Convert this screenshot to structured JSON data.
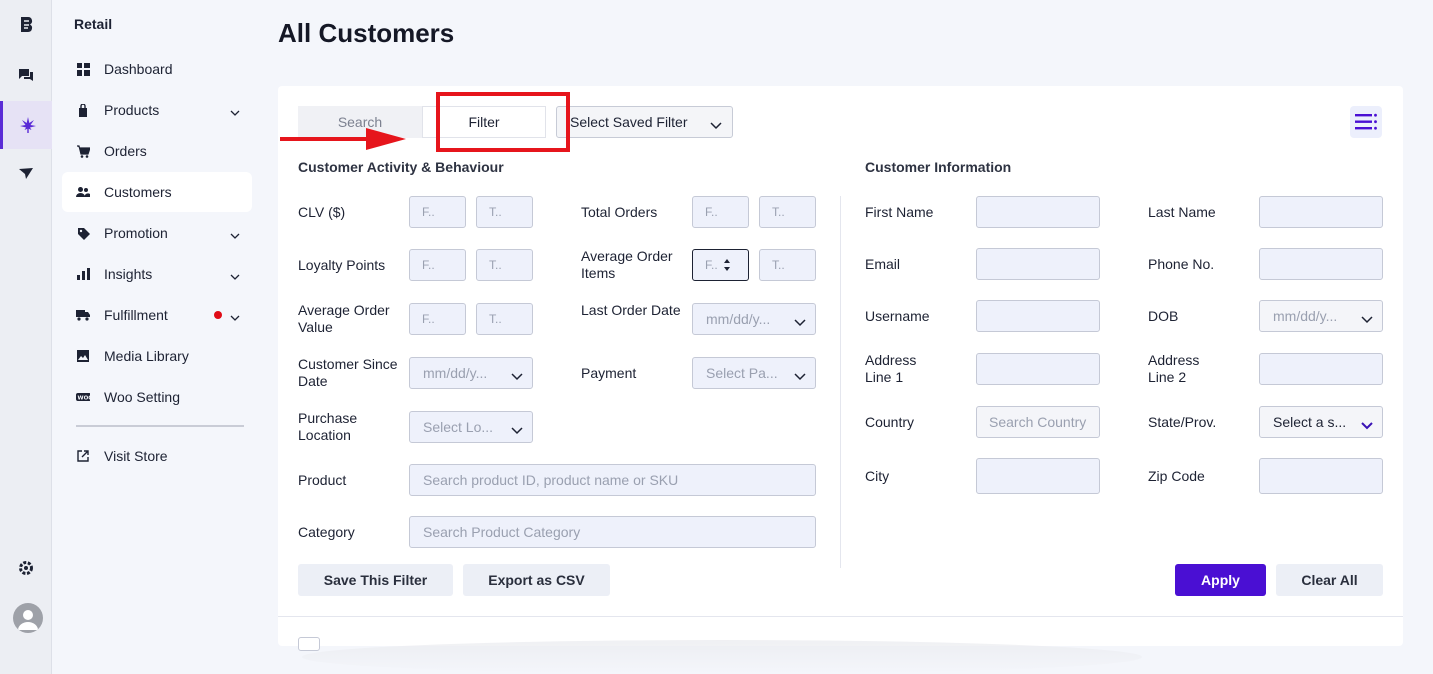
{
  "rail": {
    "icons": [
      "logo-icon",
      "chat-icon",
      "cannabis-leaf-icon",
      "send-icon",
      "gear-icon",
      "avatar-icon"
    ]
  },
  "sidebar": {
    "store_name": "Retail",
    "items": [
      {
        "label": "Dashboard",
        "icon": "dashboard-icon"
      },
      {
        "label": "Products",
        "icon": "box-icon"
      },
      {
        "label": "Orders",
        "icon": "cart-icon"
      },
      {
        "label": "Customers",
        "icon": "users-icon"
      },
      {
        "label": "Promotion",
        "icon": "tag-icon"
      },
      {
        "label": "Insights",
        "icon": "bar-chart-icon"
      },
      {
        "label": "Fulfillment",
        "icon": "truck-icon"
      },
      {
        "label": "Media Library",
        "icon": "image-icon"
      },
      {
        "label": "Woo Setting",
        "icon": "woo-icon"
      },
      {
        "label": "Visit Store",
        "icon": "external-link-icon"
      }
    ],
    "active": "Customers"
  },
  "main": {
    "title": "All Customers",
    "tabs": {
      "search": "Search",
      "filter": "Filter"
    },
    "saved_filter": "Select Saved Filter"
  },
  "activity": {
    "title": "Customer Activity & Behaviour",
    "clv": "CLV ($)",
    "loyalty": "Loyalty Points",
    "aov": "Average Order Value",
    "since": "Customer Since Date",
    "purchase_location": "Purchase Location",
    "product": "Product",
    "category": "Category",
    "total_orders": "Total Orders",
    "avg_items": "Average Order Items",
    "last_order": "Last Order Date",
    "payment": "Payment",
    "from_ph": "F..",
    "to_ph": "T..",
    "date_ph": "mm/dd/y...",
    "location_ph": "Select Lo...",
    "payment_ph": "Select Pa...",
    "product_ph": "Search product ID, product name or SKU",
    "category_ph": "Search Product Category"
  },
  "info": {
    "title": "Customer Information",
    "first_name": "First Name",
    "last_name": "Last Name",
    "email": "Email",
    "phone": "Phone No.",
    "username": "Username",
    "dob": "DOB",
    "addr1": "Address Line 1",
    "addr2": "Address Line 2",
    "country": "Country",
    "state": "State/Prov.",
    "city": "City",
    "zip": "Zip Code",
    "date_ph": "mm/dd/y...",
    "country_ph": "Search Country",
    "state_ph": "Select a s..."
  },
  "actions": {
    "save": "Save This Filter",
    "export": "Export as CSV",
    "apply": "Apply",
    "clear": "Clear All"
  },
  "colors": {
    "accent": "#4a0fd3",
    "highlight": "#e6151c",
    "notification_dot": "#e00b16"
  }
}
